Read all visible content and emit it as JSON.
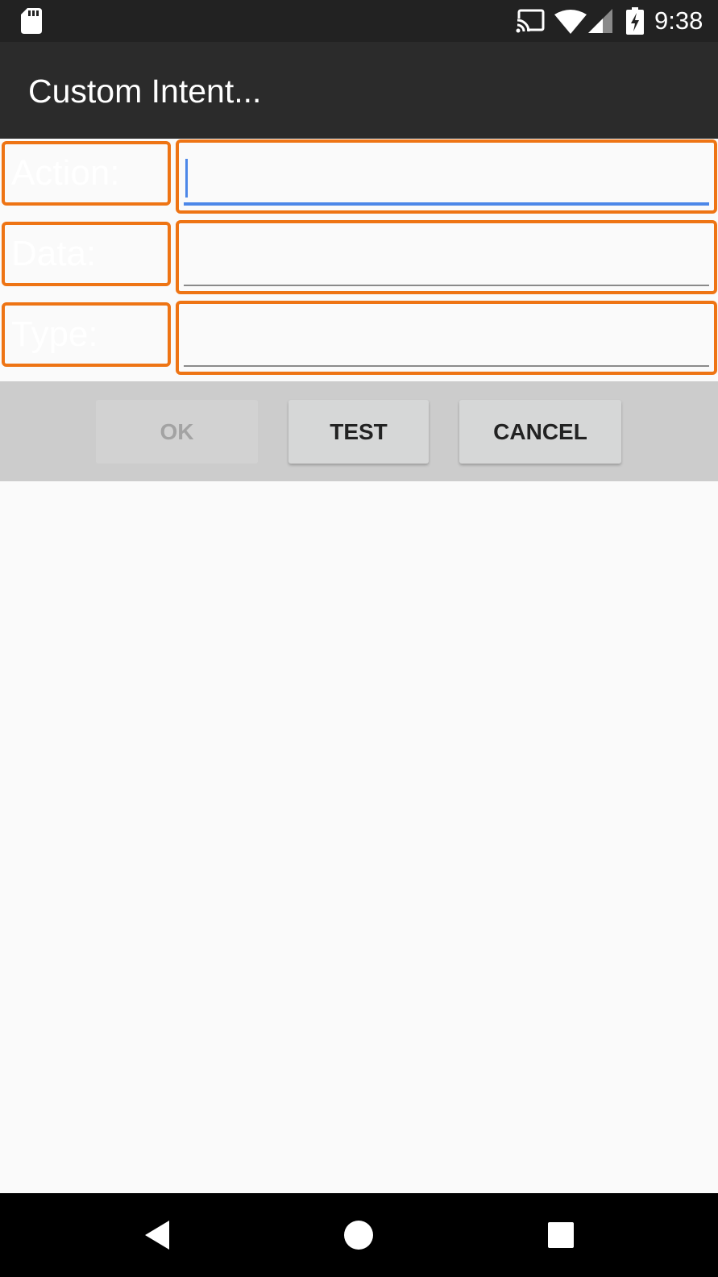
{
  "status_bar": {
    "time": "9:38",
    "icons": [
      "sd-card-icon",
      "cast-icon",
      "wifi-icon",
      "cell-signal-icon",
      "battery-charging-icon"
    ]
  },
  "title_bar": {
    "title": "Custom Intent..."
  },
  "form": {
    "rows": [
      {
        "label": "Action:",
        "value": "",
        "focused": true
      },
      {
        "label": "Data:",
        "value": "",
        "focused": false
      },
      {
        "label": "Type:",
        "value": "",
        "focused": false
      }
    ]
  },
  "buttons": {
    "ok": {
      "label": "OK",
      "enabled": false
    },
    "test": {
      "label": "TEST",
      "enabled": true
    },
    "cancel": {
      "label": "CANCEL",
      "enabled": true
    }
  },
  "nav_bar": {
    "icons": [
      "back-icon",
      "home-icon",
      "recents-icon"
    ]
  },
  "colors": {
    "status_bar": "#222222",
    "title_bar": "#2b2b2b",
    "highlight_border": "#ee7414",
    "focus_accent": "#4c87e8",
    "button_bar": "#cccccc",
    "background": "#fafafa"
  }
}
